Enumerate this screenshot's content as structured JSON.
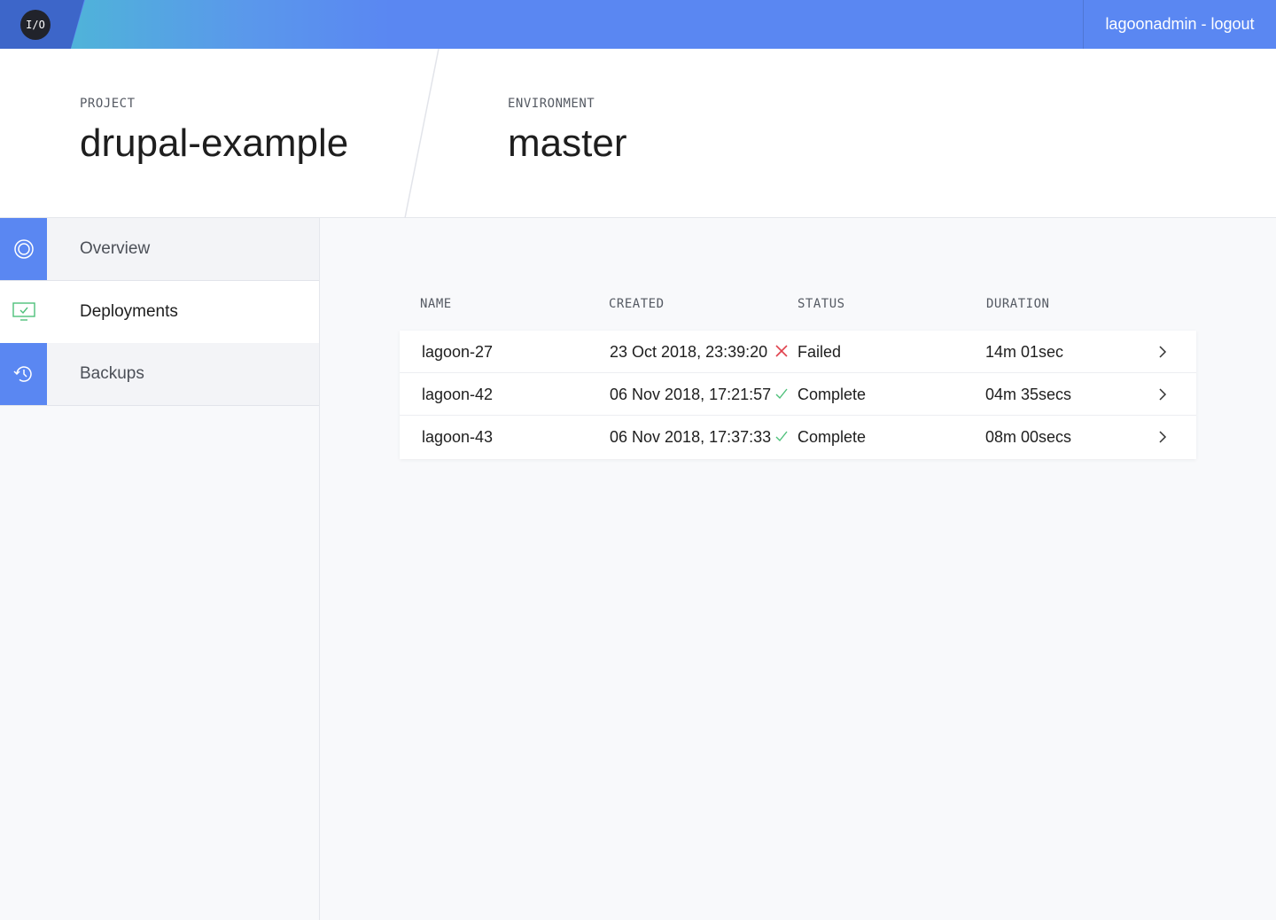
{
  "header": {
    "logo_text": "I/O",
    "user_link": "lagoonadmin - logout"
  },
  "navbar": {
    "project_label": "PROJECT",
    "project_name": "drupal-example",
    "environment_label": "ENVIRONMENT",
    "environment_name": "master"
  },
  "sidebar": {
    "items": [
      {
        "label": "Overview",
        "icon": "overview-icon",
        "active": false
      },
      {
        "label": "Deployments",
        "icon": "deployments-icon",
        "active": true
      },
      {
        "label": "Backups",
        "icon": "backups-icon",
        "active": false
      }
    ]
  },
  "table": {
    "columns": [
      "NAME",
      "CREATED",
      "STATUS",
      "DURATION"
    ],
    "rows": [
      {
        "name": "lagoon-27",
        "created": "23 Oct 2018, 23:39:20",
        "status": "Failed",
        "status_icon": "x-icon",
        "duration": "14m 01sec"
      },
      {
        "name": "lagoon-42",
        "created": "06 Nov 2018, 17:21:57",
        "status": "Complete",
        "status_icon": "check-icon",
        "duration": "04m 35secs"
      },
      {
        "name": "lagoon-43",
        "created": "06 Nov 2018, 17:37:33",
        "status": "Complete",
        "status_icon": "check-icon",
        "duration": "08m 00secs"
      }
    ]
  },
  "colors": {
    "brand_blue": "#5a87f2",
    "failed_red": "#e0414d",
    "complete_green": "#4ec07a"
  }
}
